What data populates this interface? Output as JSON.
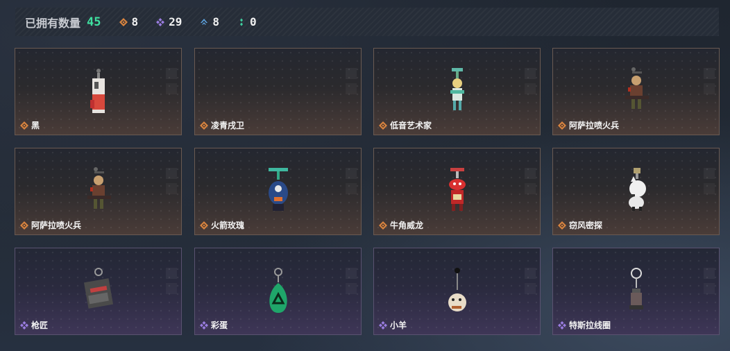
{
  "header": {
    "owned_label": "已拥有数量",
    "owned_count": "45",
    "stats": [
      {
        "icon": "orange-diamond-icon",
        "value": "8",
        "color": "#d9843f"
      },
      {
        "icon": "purple-cluster-icon",
        "value": "29",
        "color": "#9a7de0"
      },
      {
        "icon": "blue-chevron-icon",
        "value": "8",
        "color": "#5ea3e0"
      },
      {
        "icon": "green-dots-icon",
        "value": "0",
        "color": "#3fd0a0"
      }
    ]
  },
  "cards": [
    {
      "name": "黑",
      "rarity": "orange",
      "charm": "red-white-canister"
    },
    {
      "name": "凌青戌卫",
      "rarity": "orange",
      "charm": "none"
    },
    {
      "name": "低音艺术家",
      "rarity": "orange",
      "charm": "teal-figure"
    },
    {
      "name": "阿萨拉喷火兵",
      "rarity": "orange",
      "charm": "soldier-figure"
    },
    {
      "name": "阿萨拉喷火兵",
      "rarity": "orange",
      "charm": "soldier-figure"
    },
    {
      "name": "火箭玫瑰",
      "rarity": "orange",
      "charm": "blue-robot"
    },
    {
      "name": "牛角威龙",
      "rarity": "orange",
      "charm": "red-dragon"
    },
    {
      "name": "窃风密探",
      "rarity": "orange",
      "charm": "white-cat"
    },
    {
      "name": "枪匠",
      "rarity": "purple",
      "charm": "dark-crate"
    },
    {
      "name": "彩蛋",
      "rarity": "purple",
      "charm": "green-egg"
    },
    {
      "name": "小羊",
      "rarity": "purple",
      "charm": "sheep"
    },
    {
      "name": "特斯拉线圈",
      "rarity": "purple",
      "charm": "coil"
    }
  ]
}
